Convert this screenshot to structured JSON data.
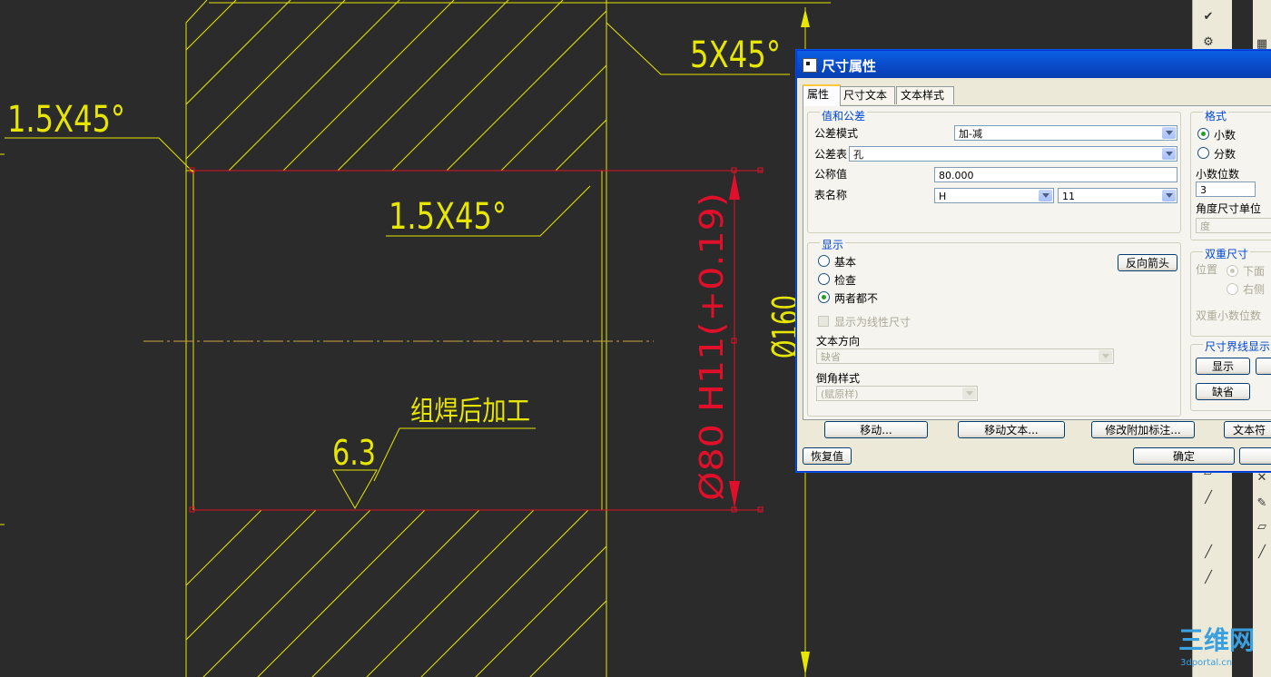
{
  "drawing": {
    "chamfer_top_right": "5X45°",
    "chamfer_left": "1.5X45°",
    "chamfer_inner": "1.5X45°",
    "dim_inner": "Ø80 H11(+0.19)",
    "dim_outer": "Ø160",
    "note": "组焊后加工",
    "roughness": "6.3",
    "colors": {
      "background": "#2b2b2b",
      "geometry": "#e6e600",
      "selected": "#e0102a",
      "centerline": "#c8a040"
    }
  },
  "dialog": {
    "title": "尺寸属性",
    "tabs": [
      {
        "label": "属性",
        "active": true
      },
      {
        "label": "尺寸文本",
        "active": false
      },
      {
        "label": "文本样式",
        "active": false
      }
    ],
    "value_group": {
      "title": "值和公差",
      "tolerance_mode_label": "公差模式",
      "tolerance_mode_value": "加-减",
      "tolerance_table_label": "公差表",
      "tolerance_table_value": "孔",
      "nominal_label": "公称值",
      "nominal_value": "80.000",
      "table_name_label": "表名称",
      "table_name_value": "H",
      "table_grade_value": "11"
    },
    "format_group": {
      "title": "格式",
      "decimal_label": "小数",
      "fraction_label": "分数",
      "decimal_places_label": "小数位数",
      "decimal_places_value": "3",
      "angle_unit_label": "角度尺寸单位",
      "angle_unit_value": "度"
    },
    "display_group": {
      "title": "显示",
      "basic_label": "基本",
      "inspection_label": "检查",
      "neither_label": "两者都不",
      "flip_arrows_button": "反向箭头",
      "linear_dim_label": "显示为线性尺寸",
      "text_direction_label": "文本方向",
      "text_direction_value": "缺省",
      "chamfer_style_label": "倒角样式",
      "chamfer_style_value": "(赋原样)"
    },
    "dual_group": {
      "title": "双重尺寸",
      "position_label": "位置",
      "below_label": "下面",
      "right_label": "右侧",
      "dual_decimals_label": "双重小数位数"
    },
    "witness_group": {
      "title": "尺寸界线显示",
      "show_button": "显示",
      "default_button": "缺省"
    },
    "bottom_buttons": {
      "move": "移动...",
      "move_text": "移动文本...",
      "modify_attach": "修改附加标注...",
      "text_sym": "文本符"
    },
    "restore_button": "恢复值",
    "ok_button": "确定"
  },
  "watermark": {
    "main": "三维网",
    "sub": "3dportal.cn"
  }
}
